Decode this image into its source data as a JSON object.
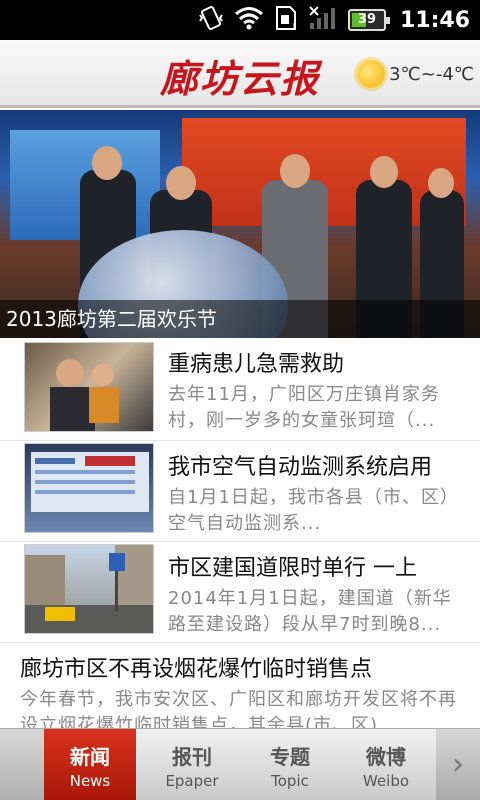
{
  "status_bar": {
    "time": "11:46",
    "battery_level": "39",
    "icons": [
      "vibrate-icon",
      "wifi-icon",
      "sim-icon",
      "signal-icon",
      "battery-icon"
    ]
  },
  "header": {
    "logo_text": "廊坊云报",
    "weather": {
      "icon": "sun-icon",
      "temperature": "3℃~-4℃"
    }
  },
  "hero": {
    "caption": "2013廊坊第二届欢乐节"
  },
  "news": [
    {
      "title": "重病患儿急需救助",
      "summary": "去年11月，广阳区万庄镇肖家务村，刚一岁多的女童张珂瑄（...",
      "thumb": "mother-and-child-photo"
    },
    {
      "title": "我市空气自动监测系统启用",
      "summary": "自1月1日起，我市各县（市、区）空气自动监测系...",
      "thumb": "monitoring-screen-photo"
    },
    {
      "title": "市区建国道限时单行 一上",
      "summary": "2014年1月1日起，建国道（新华路至建设路）段从早7时到晚8...",
      "thumb": "street-sign-photo"
    },
    {
      "title": "廊坊市区不再设烟花爆竹临时销售点",
      "summary": "今年春节，我市安次区、广阳区和廊坊开发区将不再设立烟花爆竹临时销售点，其余县(市、区)"
    }
  ],
  "tabs": [
    {
      "zh": "新闻",
      "en": "News",
      "active": true
    },
    {
      "zh": "报刊",
      "en": "Epaper",
      "active": false
    },
    {
      "zh": "专题",
      "en": "Topic",
      "active": false
    },
    {
      "zh": "微博",
      "en": "Weibo",
      "active": false
    }
  ],
  "tab_more_icon": "chevron-right-icon",
  "colors": {
    "accent": "#c8151b",
    "active_tab": "#c02412"
  }
}
